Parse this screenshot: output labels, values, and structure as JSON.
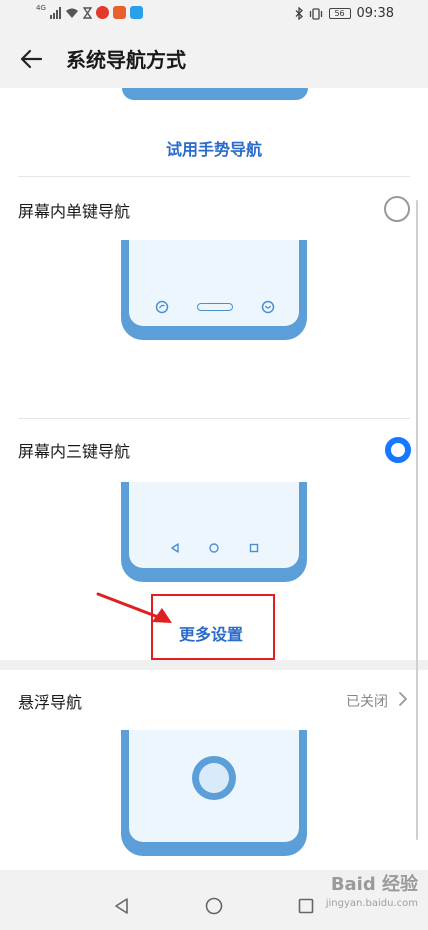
{
  "status_bar": {
    "network": "4G",
    "time": "09:38",
    "battery": "56"
  },
  "header": {
    "title": "系统导航方式"
  },
  "options": {
    "gesture_try_link": "试用手势导航",
    "single_key": {
      "label": "屏幕内单键导航",
      "selected": false
    },
    "three_key": {
      "label": "屏幕内三键导航",
      "selected": true
    },
    "more_settings": "更多设置"
  },
  "float_nav": {
    "label": "悬浮导航",
    "status": "已关闭"
  },
  "watermark": {
    "text": "Baid 经验",
    "url": "jingyan.baidu.com"
  },
  "colors": {
    "accent": "#2a6ccc",
    "radio_on": "#1677ff",
    "phone_blue": "#5c9fd8",
    "phone_screen": "#eef6fd",
    "annotation_red": "#e02020"
  },
  "icons": {
    "back": "back-arrow-icon",
    "chevron": "chevron-right-icon",
    "nav_back": "triangle-back-icon",
    "nav_home": "circle-home-icon",
    "nav_recent": "square-recent-icon"
  }
}
